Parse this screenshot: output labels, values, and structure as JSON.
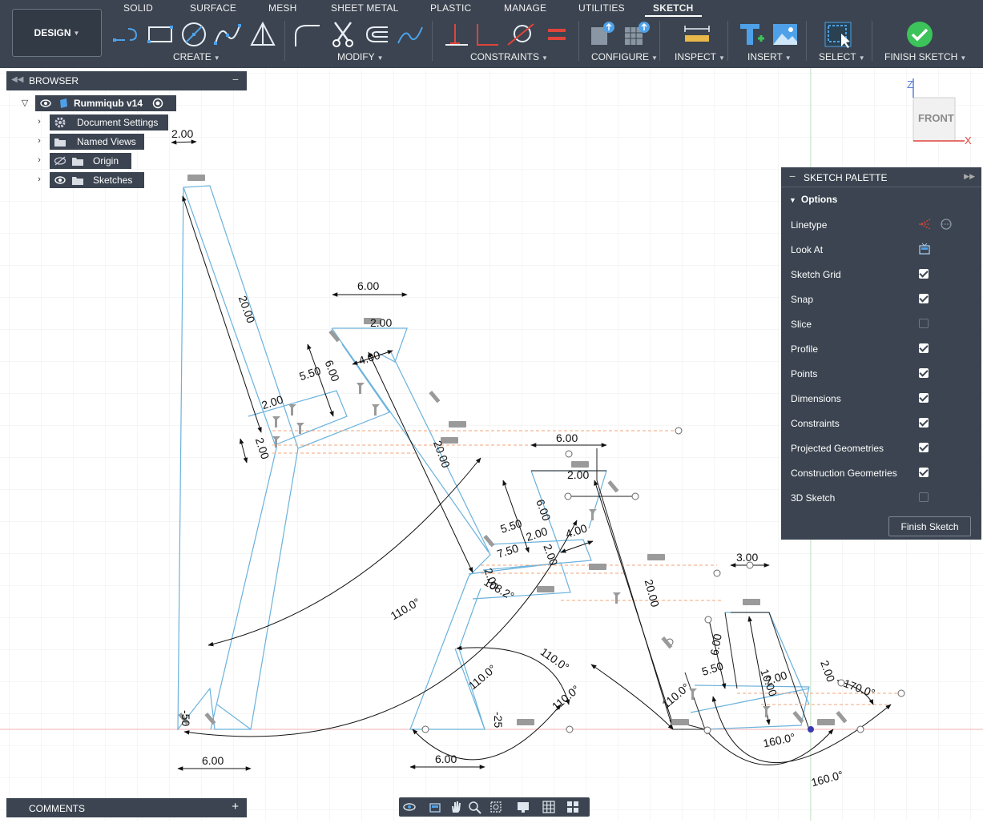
{
  "toolbar": {
    "tabs": [
      "SOLID",
      "SURFACE",
      "MESH",
      "SHEET METAL",
      "PLASTIC",
      "MANAGE",
      "UTILITIES",
      "SKETCH"
    ],
    "active_tab": "SKETCH",
    "workspace": "DESIGN",
    "groups": {
      "create": "CREATE",
      "modify": "MODIFY",
      "constraints": "CONSTRAINTS",
      "configure": "CONFIGURE",
      "inspect": "INSPECT",
      "insert": "INSERT",
      "select": "SELECT",
      "finish": "FINISH SKETCH"
    },
    "colors": {
      "bg": "#3b4450",
      "accent_blue": "#4ea1e8",
      "finish_green": "#3cc35a",
      "constraint_red": "#e0443a"
    }
  },
  "browser": {
    "title": "BROWSER",
    "root": "Rummiqub v14",
    "items": [
      "Document Settings",
      "Named Views",
      "Origin",
      "Sketches"
    ]
  },
  "viewcube": {
    "face": "FRONT",
    "axis_z": "Z",
    "axis_x": "X"
  },
  "palette": {
    "title": "SKETCH PALETTE",
    "section": "Options",
    "rows": [
      {
        "label": "Linetype",
        "kind": "icons"
      },
      {
        "label": "Look At",
        "kind": "icon"
      },
      {
        "label": "Sketch Grid",
        "kind": "check",
        "checked": true
      },
      {
        "label": "Snap",
        "kind": "check",
        "checked": true
      },
      {
        "label": "Slice",
        "kind": "check",
        "checked": false
      },
      {
        "label": "Profile",
        "kind": "check",
        "checked": true
      },
      {
        "label": "Points",
        "kind": "check",
        "checked": true
      },
      {
        "label": "Dimensions",
        "kind": "check",
        "checked": true
      },
      {
        "label": "Constraints",
        "kind": "check",
        "checked": true
      },
      {
        "label": "Projected Geometries",
        "kind": "check",
        "checked": true
      },
      {
        "label": "Construction Geometries",
        "kind": "check",
        "checked": true
      },
      {
        "label": "3D Sketch",
        "kind": "check",
        "checked": false
      }
    ],
    "finish_button": "Finish Sketch"
  },
  "comments": {
    "title": "COMMENTS"
  },
  "dimensions": {
    "d1": "2.00",
    "d2": "20.00",
    "d3": "6.00",
    "d4": "2.00",
    "d5": "5.50",
    "d6": "6.00",
    "d7": "4.00",
    "d8": "2.00",
    "d9": "2.00",
    "d10": "20.00",
    "d11": "110.0°",
    "d12": "-50",
    "d13": "6.00",
    "d14": "6.00",
    "d15": "2.00",
    "d16": "5.50",
    "d17": "6.00",
    "d18": "2.00",
    "d19": "7.50",
    "d20": "4.00",
    "d21": "2.00",
    "d22": "2.00",
    "d23": "108.2°",
    "d24": "20.00",
    "d25": "110.0°",
    "d26": "110.0°",
    "d27": "110.0°",
    "d28": "-25",
    "d29": "6.00",
    "d30": "110.0°",
    "d31": "3.00",
    "d32": "6.00",
    "d33": "5.50",
    "d34": "10.00",
    "d35": "2.00",
    "d36": "2.00",
    "d37": "170.0°",
    "d38": "160.0°",
    "d39": "160.0°"
  }
}
